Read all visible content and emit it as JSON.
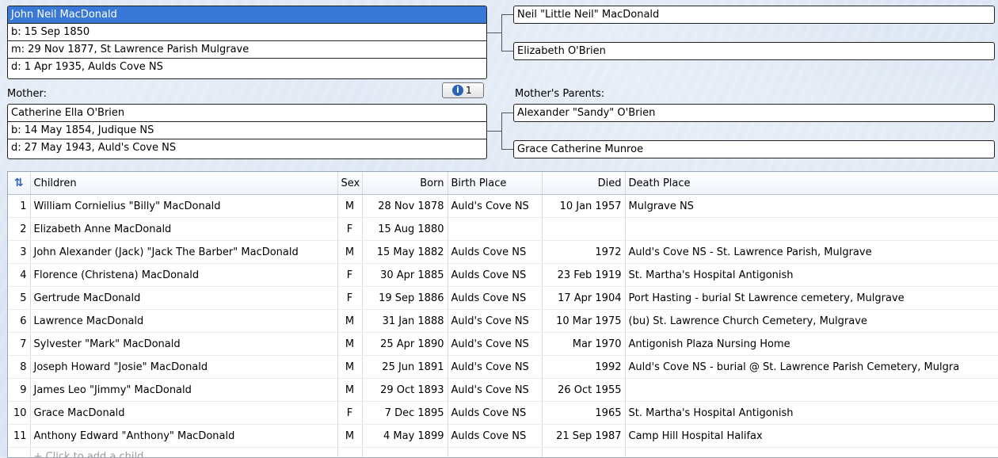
{
  "person": {
    "name": "John Neil MacDonald",
    "birth": "b: 15 Sep 1850",
    "marriage": "m: 29 Nov 1877, St Lawrence Parish Mulgrave",
    "death": "d: 1 Apr 1935, Aulds Cove NS"
  },
  "fathers_parents": {
    "father": "Neil \"Little Neil\" MacDonald",
    "mother": "Elizabeth O'Brien"
  },
  "mother": {
    "label": "Mother:",
    "name": "Catherine Ella O'Brien",
    "birth": "b: 14 May 1854, Judique NS",
    "death": "d: 27 May 1943, Auld's Cove NS",
    "info_count": "1"
  },
  "mothers_parents": {
    "label": "Mother's Parents:",
    "father": "Alexander \"Sandy\" O'Brien",
    "mother": "Grace Catherine Munroe"
  },
  "children_table": {
    "columns": [
      "Children",
      "Sex",
      "Born",
      "Birth Place",
      "Died",
      "Death Place"
    ],
    "rows": [
      [
        "1",
        "William Cornielius \"Billy\" MacDonald",
        "M",
        "28 Nov 1878",
        "Auld's Cove NS",
        "10 Jan 1957",
        "Mulgrave NS"
      ],
      [
        "2",
        "Elizabeth Anne MacDonald",
        "F",
        "15 Aug 1880",
        "",
        "",
        ""
      ],
      [
        "3",
        "John Alexander (Jack) \"Jack The Barber\" MacDonald",
        "M",
        "15 May 1882",
        "Aulds Cove NS",
        "1972",
        "Auld's Cove NS - St. Lawrence Parish, Mulgrave"
      ],
      [
        "4",
        "Florence (Christena) MacDonald",
        "F",
        "30 Apr 1885",
        "Aulds Cove NS",
        "23 Feb 1919",
        "St. Martha's Hospital Antigonish"
      ],
      [
        "5",
        "Gertrude MacDonald",
        "F",
        "19 Sep 1886",
        "Aulds Cove NS",
        "17 Apr 1904",
        "Port Hasting - burial St Lawrence cemetery, Mulgrave"
      ],
      [
        "6",
        "Lawrence MacDonald",
        "M",
        "31 Jan 1888",
        "Auld's Cove NS",
        "10 Mar 1975",
        "(bu) St. Lawrence Church Cemetery, Mulgrave"
      ],
      [
        "7",
        "Sylvester \"Mark\" MacDonald",
        "M",
        "25 Apr 1890",
        "Auld's Cove NS",
        "Mar 1970",
        "Antigonish Plaza Nursing Home"
      ],
      [
        "8",
        "Joseph Howard \"Josie\" MacDonald",
        "M",
        "25 Jun 1891",
        "Auld's Cove NS",
        "1992",
        "Auld's Cove NS - burial @ St. Lawrence Parish Cemetery, Mulgra"
      ],
      [
        "9",
        "James Leo \"Jimmy\" MacDonald",
        "M",
        "29 Oct 1893",
        "Auld's Cove NS",
        "26 Oct 1955",
        ""
      ],
      [
        "10",
        "Grace MacDonald",
        "F",
        "7 Dec 1895",
        "Aulds Cove NS",
        "1965",
        "St. Martha's Hospital Antigonish"
      ],
      [
        "11",
        "Anthony Edward \"Anthony\" MacDonald",
        "M",
        "4 May 1899",
        "Aulds Cove NS",
        "21 Sep 1987",
        "Camp Hill Hospital Halifax"
      ]
    ],
    "add_child_label": "+ Click to add a child"
  },
  "icons": {
    "sort": "sort-arrows-icon",
    "info": "info-icon"
  },
  "colors": {
    "selected": "#3a78d8",
    "accent": "#2a62b8"
  }
}
